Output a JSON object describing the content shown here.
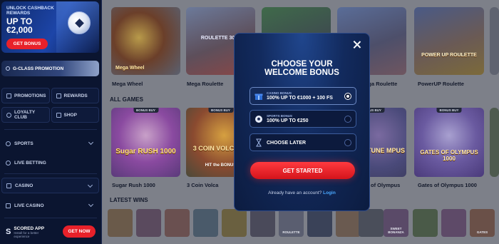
{
  "sidebar": {
    "promo": {
      "line1": "UNLOCK CASHBACK REWARDS",
      "line2": "UP TO",
      "line3": "€2,000",
      "button": "GET BONUS"
    },
    "gclass": "G-CLASS PROMOTION",
    "promotions": "PROMOTIONS",
    "rewards": "REWARDS",
    "loyalty": "LOYALTY CLUB",
    "shop": "SHOP",
    "sports": "SPORTS",
    "live_betting": "LIVE BETTING",
    "casino": "CASINO",
    "live_casino": "LIVE CASINO",
    "app": {
      "title": "SCORED APP",
      "subtitle": "Install for a better experience",
      "button": "GET NOW"
    }
  },
  "main": {
    "top_games": [
      "Mega Wheel",
      "Mega Roulette",
      "PowerUP Roulette"
    ],
    "top_tile_texts": [
      "Mega Wheel",
      "ROULETTE 3000",
      "POWER UP ROULETTE"
    ],
    "section_all": "ALL GAMES",
    "section_latest": "LATEST WINS",
    "badge": "BONUS BUY",
    "games": [
      "Sugar Rush 1000",
      "3 Coin Volca",
      "of Olympus",
      "Gates of Olympus 1000"
    ],
    "tile_texts": {
      "sugar": "Sugar RUSH 1000",
      "volcano": "3 COIN VOLCANO",
      "hit": "HIT the BONUS",
      "fortune": "TUNE MPUS",
      "gates": "GATES OF OLYMPUS 1000"
    },
    "wins": [
      "ROULETTE",
      "DICE TRACK",
      "FOOTBALL",
      "SWEET BONANZA",
      "GATES"
    ]
  },
  "modal": {
    "title_line1": "CHOOSE YOUR",
    "title_line2": "WELCOME BONUS",
    "options": [
      {
        "small": "CASINO BONUS",
        "big": "100% UP TO €1000 + 100 FS"
      },
      {
        "small": "SPORTS BONUS",
        "big": "100% UP TO €250"
      },
      {
        "small": "",
        "big": "CHOOSE LATER"
      }
    ],
    "cta": "GET STARTED",
    "already": "Already have an account?",
    "login": "Login"
  }
}
